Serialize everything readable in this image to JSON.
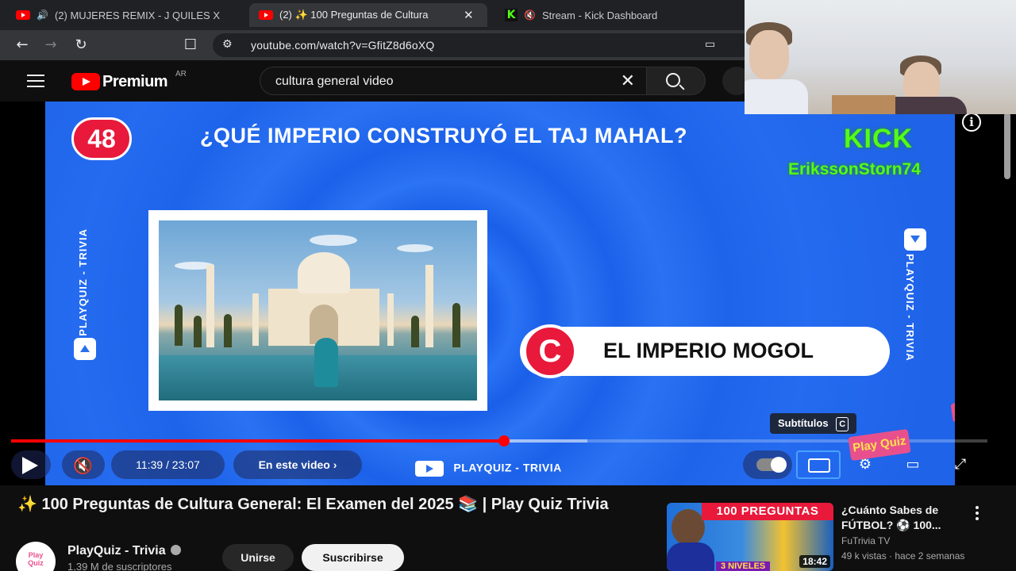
{
  "browser": {
    "tabs": [
      {
        "title": "(2) MUJERES REMIX - J QUILES X",
        "favicon": "youtube-icon",
        "active": false
      },
      {
        "title": "(2) ✨ 100 Preguntas de Cultura",
        "favicon": "youtube-icon",
        "active": true
      },
      {
        "title": "Stream - Kick Dashboard",
        "favicon": "kick-icon",
        "active": false
      }
    ],
    "url": "youtube.com/watch?v=GfitZ8d6oXQ"
  },
  "header": {
    "logo_text": "Premium",
    "region": "AR",
    "search_query": "cultura general video"
  },
  "video_content": {
    "question_number": "48",
    "question": "¿QUÉ IMPERIO CONSTRUYÓ EL TAJ MAHAL?",
    "answer_letter": "C",
    "answer_text": "EL IMPERIO MOGOL",
    "side_label": "PLAYQUIZ - TRIVIA",
    "overlay_brand": "KICK",
    "overlay_username": "ErikssonStorn74"
  },
  "player": {
    "time": "11:39 / 23:07",
    "chapter_button": "En este video",
    "channel_brand": "PLAYQUIZ - TRIVIA",
    "tooltip_label": "Subtítulos",
    "tooltip_key": "C",
    "progress_played": 0.505,
    "progress_buffered": 0.59
  },
  "video_info": {
    "title": "✨ 100 Preguntas de Cultura General: El Examen del 2025 📚 | Play Quiz Trivia",
    "channel_name": "PlayQuiz - Trivia",
    "subscribers": "1,39 M de suscriptores",
    "join_label": "Unirse",
    "subscribe_label": "Suscribirse"
  },
  "recommended": [
    {
      "thumb_banner": "100 PREGUNTAS",
      "thumb_sub": "3 NIVELES",
      "duration": "18:42",
      "title": "¿Cuánto Sabes de FÚTBOL? ⚽ 100...",
      "channel": "FuTrivia TV",
      "meta": "49 k vistas · hace 2 semanas"
    }
  ],
  "colors": {
    "youtube_red": "#ff0000",
    "kick_green": "#53fc18",
    "quiz_blue": "#2a73f5",
    "quiz_red": "#e8193a"
  }
}
